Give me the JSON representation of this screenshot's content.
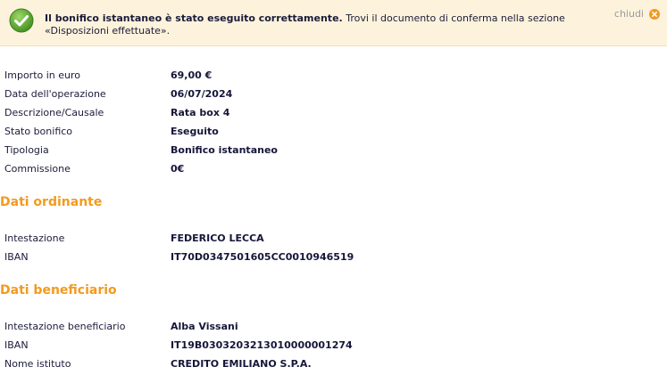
{
  "banner": {
    "strong_text": "Il bonifico istantaneo è stato eseguito correttamente.",
    "normal_text": " Trovi il documento di conferma nella sezione «Disposizioni effettuate».",
    "close_label": "chiudi",
    "icon": "check-circle-icon",
    "close_icon": "close-circle-icon",
    "colors": {
      "background": "#fdf3dc",
      "success": "#5aa52c",
      "close": "#f39a1f"
    }
  },
  "details": [
    {
      "label": "Importo in euro",
      "value": "69,00 €"
    },
    {
      "label": "Data dell'operazione",
      "value": "06/07/2024"
    },
    {
      "label": "Descrizione/Causale",
      "value": "Rata box 4"
    },
    {
      "label": "Stato bonifico",
      "value": "Eseguito"
    },
    {
      "label": "Tipologia",
      "value": "Bonifico istantaneo"
    },
    {
      "label": "Commissione",
      "value": "0€"
    }
  ],
  "ordinante": {
    "title": "Dati ordinante",
    "rows": [
      {
        "label": "Intestazione",
        "value": "FEDERICO LECCA"
      },
      {
        "label": "IBAN",
        "value": "IT70D0347501605CC0010946519"
      }
    ]
  },
  "beneficiario": {
    "title": "Dati beneficiario",
    "rows": [
      {
        "label": "Intestazione beneficiario",
        "value": "Alba Vissani"
      },
      {
        "label": "IBAN",
        "value": "IT19B0303203213010000001274"
      },
      {
        "label": "Nome istituto",
        "value": "CREDITO EMILIANO S.P.A."
      }
    ]
  },
  "accent_color": "#f39a1f"
}
